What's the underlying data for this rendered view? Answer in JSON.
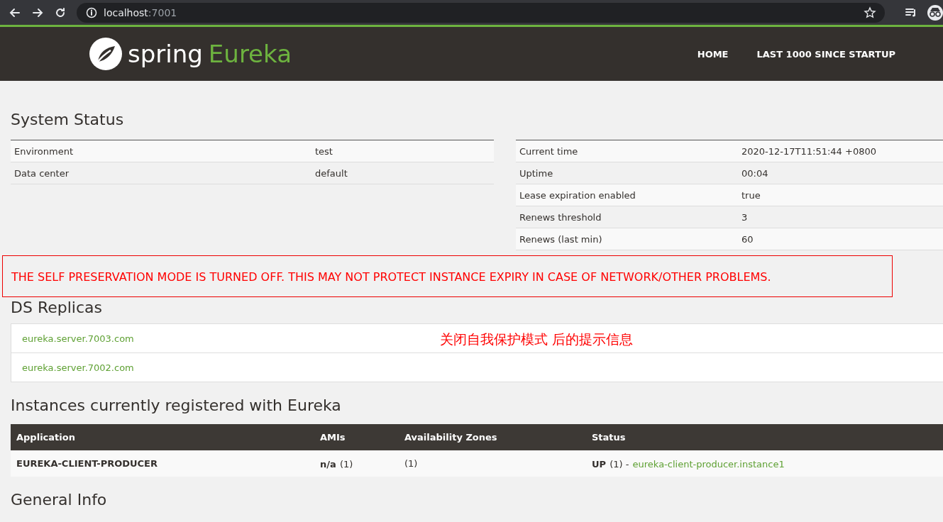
{
  "browser": {
    "url_host": "localhost",
    "url_port": ":7001"
  },
  "header": {
    "logo_word": "spring",
    "logo_product": "Eureka",
    "nav": [
      {
        "label": "HOME"
      },
      {
        "label": "LAST 1000 SINCE STARTUP"
      }
    ]
  },
  "system_status": {
    "title": "System Status",
    "left_rows": [
      {
        "label": "Environment",
        "value": "test"
      },
      {
        "label": "Data center",
        "value": "default"
      }
    ],
    "right_rows": [
      {
        "label": "Current time",
        "value": "2020-12-17T11:51:44 +0800"
      },
      {
        "label": "Uptime",
        "value": "00:04"
      },
      {
        "label": "Lease expiration enabled",
        "value": "true"
      },
      {
        "label": "Renews threshold",
        "value": "3"
      },
      {
        "label": "Renews (last min)",
        "value": "60"
      }
    ]
  },
  "warning": "THE SELF PRESERVATION MODE IS TURNED OFF. THIS MAY NOT PROTECT INSTANCE EXPIRY IN CASE OF NETWORK/OTHER PROBLEMS.",
  "ds_replicas": {
    "title": "DS Replicas",
    "items": [
      "eureka.server.7003.com",
      "eureka.server.7002.com"
    ]
  },
  "annotation": "关闭自我保护模式 后的提示信息",
  "instances": {
    "title": "Instances currently registered with Eureka",
    "columns": [
      "Application",
      "AMIs",
      "Availability Zones",
      "Status"
    ],
    "rows": [
      {
        "application": "EUREKA-CLIENT-PRODUCER",
        "amis": "n/a",
        "amis_count": "(1)",
        "zones": "(1)",
        "status": "UP",
        "status_count": "(1) -",
        "instance": "eureka-client-producer.instance1"
      }
    ]
  },
  "general_info": {
    "title": "General Info"
  }
}
